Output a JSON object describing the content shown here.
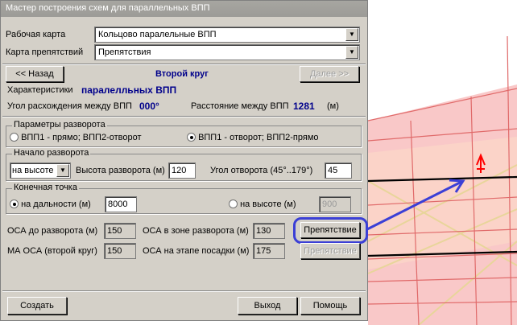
{
  "window": {
    "title": "Мастер построения схем для параллельных ВПП"
  },
  "work_map": {
    "label": "Рабочая карта",
    "value": "Кольцово паралельные ВПП"
  },
  "obstacle_map": {
    "label": "Карта препятствий",
    "value": "Препятствия"
  },
  "nav": {
    "back_label": "<< Назад",
    "step_title": "Второй круг",
    "next_label": "Далее >>"
  },
  "characteristics": {
    "label": "Характеристики",
    "subtitle": "паралелльных ВПП",
    "angle_label": "Угол расхождения между ВПП",
    "angle_value": "000°",
    "distance_label": "Расстояние между ВПП",
    "distance_value": "1281",
    "distance_unit": "(м)"
  },
  "turn_params": {
    "title": "Параметры разворота",
    "option1": "ВПП1 - прямо;  ВПП2-отворот",
    "option2": "ВПП1 - отворот;  ВПП2-прямо",
    "selected": 2
  },
  "turn_start": {
    "title": "Начало разворота",
    "mode_value": "на высоте",
    "height_label": "Высота разворота (м)",
    "height_value": "120",
    "angle_label": "Угол отворота (45°..179°)",
    "angle_value": "45"
  },
  "end_point": {
    "title": "Конечная точка",
    "distance_label": "на дальности  (м)",
    "distance_value": "8000",
    "height_label": "на высоте  (м)",
    "height_value": "900"
  },
  "oca": {
    "before_turn_label": "ОСА до разворота  (м)",
    "before_turn_value": "150",
    "turn_zone_label": "ОСА в зоне разворота  (м)",
    "turn_zone_value": "130",
    "obstacle_btn_label": "Препятствие",
    "missed_label": "МА ОСА (второй круг)",
    "missed_value": "150",
    "landing_label": "ОСА на этапе посадки  (м)",
    "landing_value": "175",
    "obstacle_btn2_label": "Препятствие"
  },
  "footer": {
    "create_label": "Создать",
    "exit_label": "Выход",
    "help_label": "Помощь"
  },
  "colors": {
    "dialog_bg": "#d4d0c8",
    "map_fill": "#f9c8c8",
    "map_line": "#e06a6a",
    "accent_blue": "#3b3fd6",
    "marker_red": "#ff0000"
  }
}
